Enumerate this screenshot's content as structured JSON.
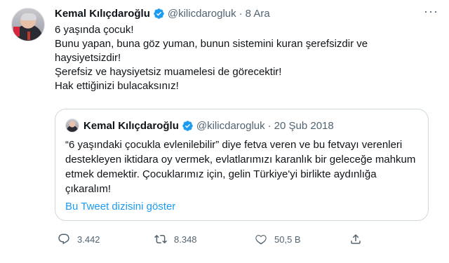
{
  "tweet": {
    "author_name": "Kemal Kılıçdaroğlu",
    "handle": "@kilicdarogluk",
    "separator": "·",
    "date": "8 Ara",
    "more_icon": "ellipsis-icon",
    "lines": [
      "6 yaşında çocuk!",
      "Bunu yapan, buna göz yuman, bunun sistemini kuran şerefsizdir ve haysiyetsizdir!",
      "Şerefsiz ve haysiyetsiz muamelesi de görecektir!",
      "Hak ettiğinizi bulacaksınız!"
    ]
  },
  "quote": {
    "author_name": "Kemal Kılıçdaroğlu",
    "handle": "@kilicdarogluk",
    "separator": "·",
    "date": "20 Şub 2018",
    "text": "“6 yaşındaki çocukla evlenilebilir” diye fetva veren ve bu fetvayı verenleri destekleyen iktidara oy vermek, evlatlarımızı karanlık bir geleceğe mahkum etmek demektir. Çocuklarımız için, gelin Türkiye'yi birlikte aydınlığa çıkaralım!",
    "thread_link": "Bu Tweet dizisini göster"
  },
  "actions": {
    "replies": "3.442",
    "retweets": "8.348",
    "likes": "50,5 B"
  },
  "colors": {
    "accent": "#1d9bf0",
    "muted": "#536471",
    "text": "#0f1419",
    "border": "#cfd9de"
  }
}
